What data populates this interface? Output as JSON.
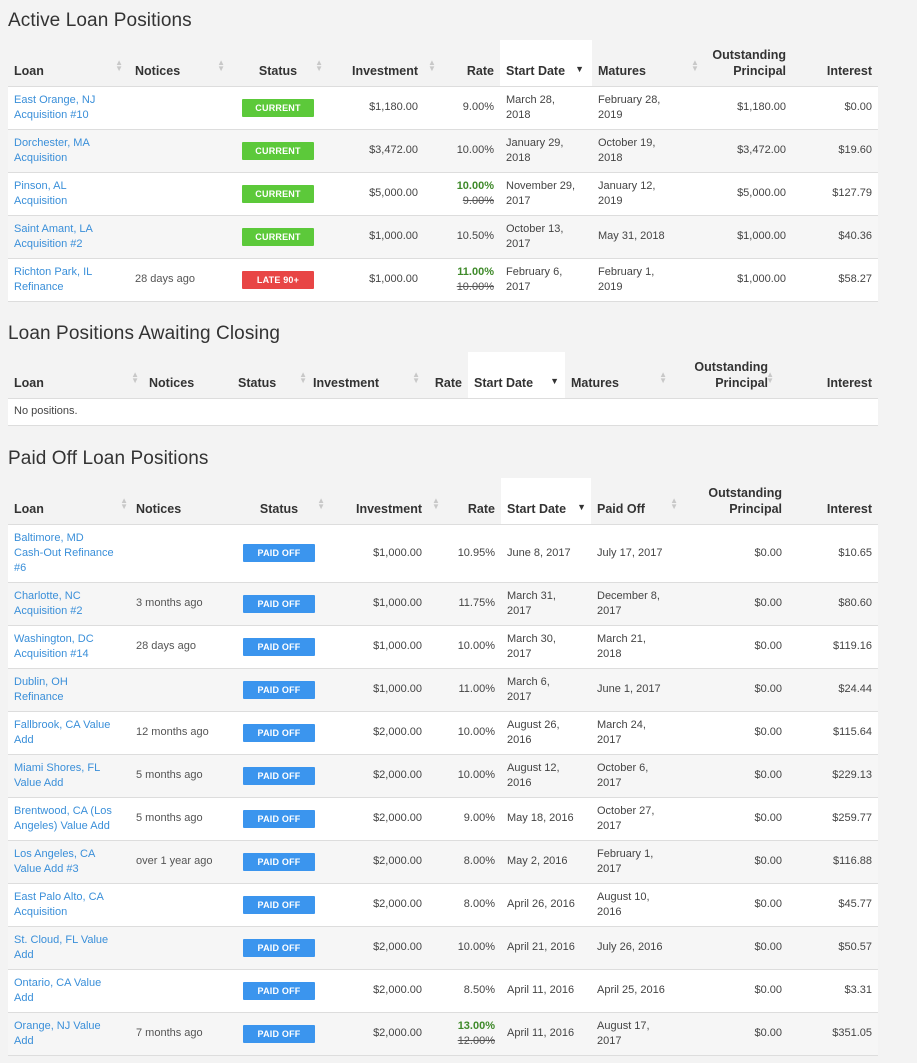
{
  "sections": {
    "active_title": "Active Loan Positions",
    "awaiting_title": "Loan Positions Awaiting Closing",
    "paidoff_title": "Paid Off Loan Positions"
  },
  "columns": {
    "loan": "Loan",
    "notices": "Notices",
    "status": "Status",
    "investment": "Investment",
    "rate": "Rate",
    "start_date": "Start Date",
    "matures": "Matures",
    "paid_off": "Paid Off",
    "outstanding_1": "Outstanding",
    "outstanding_2": "Principal",
    "interest": "Interest"
  },
  "icons": {
    "sort": "sort-arrows-icon",
    "sort_desc": "caret-down-icon"
  },
  "colors": {
    "current": "#5cc93a",
    "late": "#e84545",
    "paid_off": "#3b95ee",
    "link": "#3a8fd9",
    "rate_up": "#3f8a2a"
  },
  "active_rows": [
    {
      "loan_1": "East Orange, NJ",
      "loan_2": "Acquisition #10",
      "notices": "",
      "status": "CURRENT",
      "investment": "$1,180.00",
      "rate": "9.00%",
      "rate_old": "",
      "start_1": "March 28,",
      "start_2": "2018",
      "end_1": "February 28,",
      "end_2": "2019",
      "outstanding": "$1,180.00",
      "interest": "$0.00"
    },
    {
      "loan_1": "Dorchester, MA",
      "loan_2": "Acquisition",
      "notices": "",
      "status": "CURRENT",
      "investment": "$3,472.00",
      "rate": "10.00%",
      "rate_old": "",
      "start_1": "January 29,",
      "start_2": "2018",
      "end_1": "October 19,",
      "end_2": "2018",
      "outstanding": "$3,472.00",
      "interest": "$19.60"
    },
    {
      "loan_1": "Pinson, AL",
      "loan_2": "Acquisition",
      "notices": "",
      "status": "CURRENT",
      "investment": "$5,000.00",
      "rate": "10.00%",
      "rate_old": "9.00%",
      "start_1": "November 29,",
      "start_2": "2017",
      "end_1": "January 12,",
      "end_2": "2019",
      "outstanding": "$5,000.00",
      "interest": "$127.79"
    },
    {
      "loan_1": "Saint Amant, LA",
      "loan_2": "Acquisition #2",
      "notices": "",
      "status": "CURRENT",
      "investment": "$1,000.00",
      "rate": "10.50%",
      "rate_old": "",
      "start_1": "October 13,",
      "start_2": "2017",
      "end_1": "May 31, 2018",
      "end_2": "",
      "outstanding": "$1,000.00",
      "interest": "$40.36"
    },
    {
      "loan_1": "Richton Park, IL",
      "loan_2": "Refinance",
      "notices": "28 days ago",
      "status": "LATE 90+",
      "investment": "$1,000.00",
      "rate": "11.00%",
      "rate_old": "10.00%",
      "start_1": "February 6,",
      "start_2": "2017",
      "end_1": "February 1,",
      "end_2": "2019",
      "outstanding": "$1,000.00",
      "interest": "$58.27"
    }
  ],
  "awaiting_empty": "No positions.",
  "paid_rows": [
    {
      "loan_1": "Baltimore, MD",
      "loan_2": "Cash-Out Refinance",
      "loan_3": "#6",
      "notices": "",
      "status": "PAID OFF",
      "investment": "$1,000.00",
      "rate": "10.95%",
      "rate_old": "",
      "start_1": "June 8, 2017",
      "start_2": "",
      "end_1": "July 17, 2017",
      "end_2": "",
      "outstanding": "$0.00",
      "interest": "$10.65"
    },
    {
      "loan_1": "Charlotte, NC",
      "loan_2": "Acquisition #2",
      "loan_3": "",
      "notices": "3 months ago",
      "status": "PAID OFF",
      "investment": "$1,000.00",
      "rate": "11.75%",
      "rate_old": "",
      "start_1": "March 31,",
      "start_2": "2017",
      "end_1": "December 8,",
      "end_2": "2017",
      "outstanding": "$0.00",
      "interest": "$80.60"
    },
    {
      "loan_1": "Washington, DC",
      "loan_2": "Acquisition #14",
      "loan_3": "",
      "notices": "28 days ago",
      "status": "PAID OFF",
      "investment": "$1,000.00",
      "rate": "10.00%",
      "rate_old": "",
      "start_1": "March 30,",
      "start_2": "2017",
      "end_1": "March 21,",
      "end_2": "2018",
      "outstanding": "$0.00",
      "interest": "$119.16"
    },
    {
      "loan_1": "Dublin, OH",
      "loan_2": "Refinance",
      "loan_3": "",
      "notices": "",
      "status": "PAID OFF",
      "investment": "$1,000.00",
      "rate": "11.00%",
      "rate_old": "",
      "start_1": "March 6,",
      "start_2": "2017",
      "end_1": "June 1, 2017",
      "end_2": "",
      "outstanding": "$0.00",
      "interest": "$24.44"
    },
    {
      "loan_1": "Fallbrook, CA Value",
      "loan_2": "Add",
      "loan_3": "",
      "notices": "12 months ago",
      "status": "PAID OFF",
      "investment": "$2,000.00",
      "rate": "10.00%",
      "rate_old": "",
      "start_1": "August 26,",
      "start_2": "2016",
      "end_1": "March 24,",
      "end_2": "2017",
      "outstanding": "$0.00",
      "interest": "$115.64"
    },
    {
      "loan_1": "Miami Shores, FL",
      "loan_2": "Value Add",
      "loan_3": "",
      "notices": "5 months ago",
      "status": "PAID OFF",
      "investment": "$2,000.00",
      "rate": "10.00%",
      "rate_old": "",
      "start_1": "August 12,",
      "start_2": "2016",
      "end_1": "October 6,",
      "end_2": "2017",
      "outstanding": "$0.00",
      "interest": "$229.13"
    },
    {
      "loan_1": "Brentwood, CA (Los",
      "loan_2": "Angeles) Value Add",
      "loan_3": "",
      "notices": "5 months ago",
      "status": "PAID OFF",
      "investment": "$2,000.00",
      "rate": "9.00%",
      "rate_old": "",
      "start_1": "May 18, 2016",
      "start_2": "",
      "end_1": "October 27,",
      "end_2": "2017",
      "outstanding": "$0.00",
      "interest": "$259.77"
    },
    {
      "loan_1": "Los Angeles, CA",
      "loan_2": "Value Add #3",
      "loan_3": "",
      "notices": "over 1 year ago",
      "status": "PAID OFF",
      "investment": "$2,000.00",
      "rate": "8.00%",
      "rate_old": "",
      "start_1": "May 2, 2016",
      "start_2": "",
      "end_1": "February 1,",
      "end_2": "2017",
      "outstanding": "$0.00",
      "interest": "$116.88"
    },
    {
      "loan_1": "East Palo Alto, CA",
      "loan_2": "Acquisition",
      "loan_3": "",
      "notices": "",
      "status": "PAID OFF",
      "investment": "$2,000.00",
      "rate": "8.00%",
      "rate_old": "",
      "start_1": "April 26, 2016",
      "start_2": "",
      "end_1": "August 10,",
      "end_2": "2016",
      "outstanding": "$0.00",
      "interest": "$45.77"
    },
    {
      "loan_1": "St. Cloud, FL Value",
      "loan_2": "Add",
      "loan_3": "",
      "notices": "",
      "status": "PAID OFF",
      "investment": "$2,000.00",
      "rate": "10.00%",
      "rate_old": "",
      "start_1": "April 21, 2016",
      "start_2": "",
      "end_1": "July 26, 2016",
      "end_2": "",
      "outstanding": "$0.00",
      "interest": "$50.57"
    },
    {
      "loan_1": "Ontario, CA Value",
      "loan_2": "Add",
      "loan_3": "",
      "notices": "",
      "status": "PAID OFF",
      "investment": "$2,000.00",
      "rate": "8.50%",
      "rate_old": "",
      "start_1": "April 11, 2016",
      "start_2": "",
      "end_1": "April 25, 2016",
      "end_2": "",
      "outstanding": "$0.00",
      "interest": "$3.31"
    },
    {
      "loan_1": "Orange, NJ Value",
      "loan_2": "Add",
      "loan_3": "",
      "notices": "7 months ago",
      "status": "PAID OFF",
      "investment": "$2,000.00",
      "rate": "13.00%",
      "rate_old": "12.00%",
      "start_1": "April 11, 2016",
      "start_2": "",
      "end_1": "August 17,",
      "end_2": "2017",
      "outstanding": "$0.00",
      "interest": "$351.05"
    }
  ]
}
